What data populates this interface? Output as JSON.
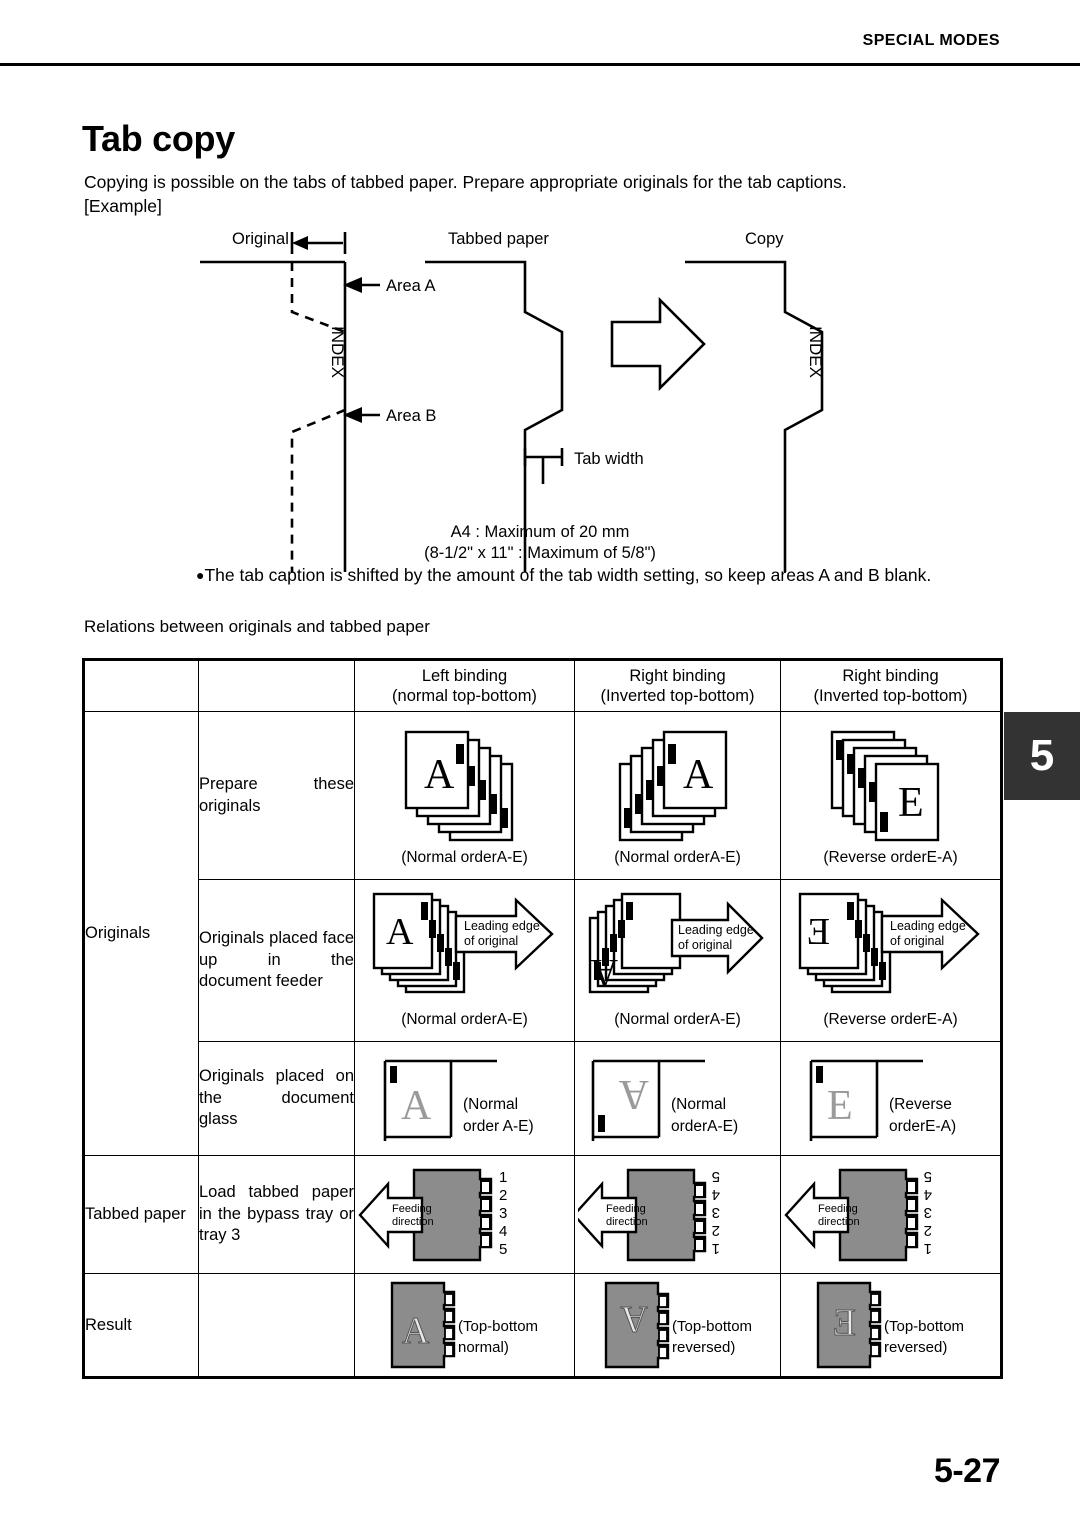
{
  "header": {
    "title": "SPECIAL MODES"
  },
  "page": {
    "title": "Tab copy",
    "intro_line1": "Copying is possible on the tabs of tabbed paper. Prepare appropriate originals for the tab captions.",
    "intro_line2": "[Example]",
    "number": "5-27",
    "chapter": "5"
  },
  "diagram": {
    "label_original": "Original",
    "label_tabbed_paper": "Tabbed paper",
    "label_copy": "Copy",
    "label_area_a": "Area A",
    "label_area_b": "Area B",
    "label_index_left": "INDEX",
    "label_index_right": "INDEX",
    "label_tab_width": "Tab width",
    "note_a4": "A4 : Maximum of 20 mm",
    "note_inch": "(8-1/2\" x 11\" : Maximum of 5/8\")",
    "bullet": "The tab caption is shifted by the amount of the tab width setting, so keep areas A and B blank.",
    "bullet_marker": "●"
  },
  "table": {
    "caption": "Relations between originals and tabbed paper",
    "headers": [
      {
        "line1": "",
        "line2": ""
      },
      {
        "line1": "",
        "line2": ""
      },
      {
        "line1": "Left binding",
        "line2": "(normal top-bottom)"
      },
      {
        "line1": "Right binding",
        "line2": "(Inverted top-bottom)"
      },
      {
        "line1": "Right binding",
        "line2": "(Inverted top-bottom)"
      }
    ],
    "row_groups": {
      "originals": "Originals",
      "tabbed_paper": "Tabbed paper",
      "result": "Result"
    },
    "rows": [
      {
        "desc_head": "Prepare these",
        "desc_tail": "originals",
        "captions": [
          "(Normal orderA-E)",
          "(Normal orderA-E)",
          "(Reverse orderE-A)"
        ],
        "letters": [
          "A",
          "A",
          "E"
        ]
      },
      {
        "desc_head": "Originals placed face up in the",
        "desc_tail": "document feeder",
        "captions": [
          "(Normal orderA-E)",
          "(Normal orderA-E)",
          "(Reverse orderE-A)"
        ],
        "letters": [
          "A",
          "A",
          "E"
        ],
        "arrow_label_line1": "Leading edge",
        "arrow_label_line2": "of original"
      },
      {
        "desc_head": "Originals placed on the document",
        "desc_tail": "glass",
        "captions_line1": [
          "(Normal",
          "(Normal",
          "(Reverse"
        ],
        "captions_line2": [
          "order A-E)",
          "orderA-E)",
          "orderE-A)"
        ],
        "letters": [
          "A",
          "A",
          "E"
        ]
      },
      {
        "desc_head": "Load tabbed paper in the bypass tray or",
        "desc_tail": "tray 3",
        "feeding_label_line1": "Feeding",
        "feeding_label_line2": "direction",
        "tab_numbers_normal": [
          "1",
          "2",
          "3",
          "4",
          "5"
        ],
        "tab_numbers_inverted": [
          "5",
          "4",
          "3",
          "2",
          "1"
        ]
      },
      {
        "desc_head": "",
        "desc_tail": "",
        "captions_line1": [
          "(Top-bottom",
          "(Top-bottom",
          "(Top-bottom"
        ],
        "captions_line2": [
          "normal)",
          "reversed)",
          "reversed)"
        ],
        "letters": [
          "A",
          "A",
          "E"
        ]
      }
    ]
  },
  "colors": {
    "tab_sheet_gray": "#8c8c8c",
    "chapter_tab_bg": "#333333",
    "line": "#000000"
  }
}
